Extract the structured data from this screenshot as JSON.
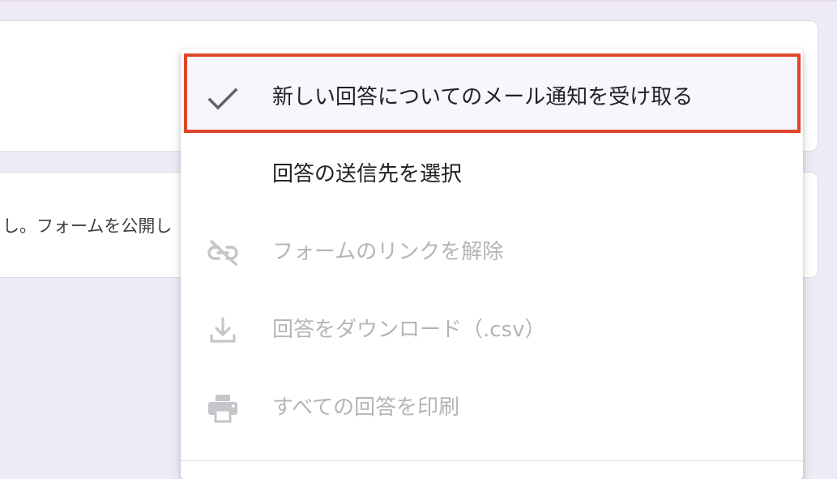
{
  "background_text": {
    "card2_text": "し。フォームを公開し"
  },
  "menu": {
    "items": [
      {
        "label": "新しい回答についてのメール通知を受け取る",
        "icon": "check-icon",
        "checked": true,
        "enabled": true
      },
      {
        "label": "回答の送信先を選択",
        "icon": "",
        "checked": false,
        "enabled": true
      },
      {
        "label": "フォームのリンクを解除",
        "icon": "unlink-icon",
        "checked": false,
        "enabled": false
      },
      {
        "label": "回答をダウンロード（.csv）",
        "icon": "download-icon",
        "checked": false,
        "enabled": false
      },
      {
        "label": "すべての回答を印刷",
        "icon": "print-icon",
        "checked": false,
        "enabled": false
      }
    ]
  },
  "colors": {
    "highlight_border": "#e0452a",
    "disabled_text": "#b3b5b8",
    "icon_enabled": "#5f6368",
    "icon_disabled": "#c4c6c9",
    "background": "#efebf6"
  }
}
